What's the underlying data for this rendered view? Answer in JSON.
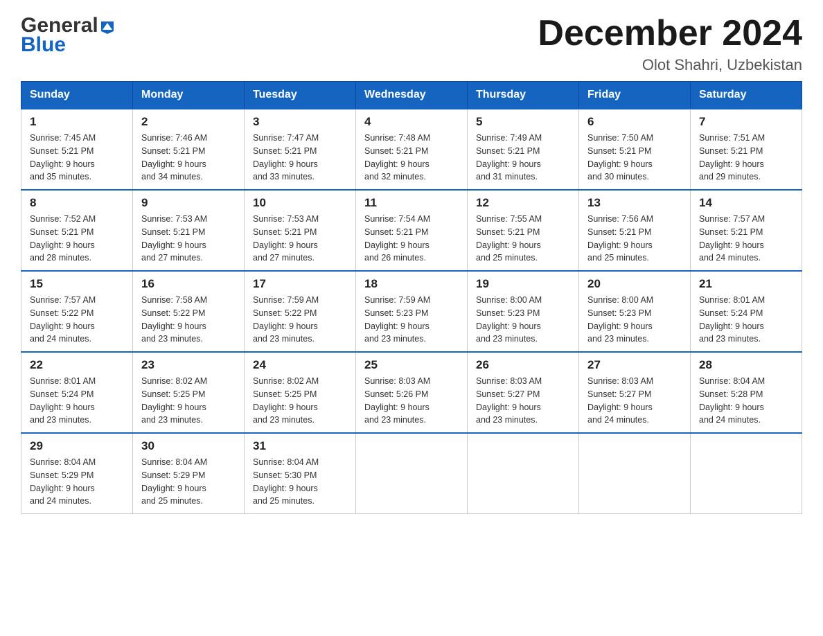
{
  "logo": {
    "line1": "General",
    "triangle": "▶",
    "line2": "Blue"
  },
  "title": "December 2024",
  "location": "Olot Shahri, Uzbekistan",
  "weekdays": [
    "Sunday",
    "Monday",
    "Tuesday",
    "Wednesday",
    "Thursday",
    "Friday",
    "Saturday"
  ],
  "weeks": [
    [
      {
        "day": "1",
        "sunrise": "7:45 AM",
        "sunset": "5:21 PM",
        "daylight_h": "9",
        "daylight_m": "35"
      },
      {
        "day": "2",
        "sunrise": "7:46 AM",
        "sunset": "5:21 PM",
        "daylight_h": "9",
        "daylight_m": "34"
      },
      {
        "day": "3",
        "sunrise": "7:47 AM",
        "sunset": "5:21 PM",
        "daylight_h": "9",
        "daylight_m": "33"
      },
      {
        "day": "4",
        "sunrise": "7:48 AM",
        "sunset": "5:21 PM",
        "daylight_h": "9",
        "daylight_m": "32"
      },
      {
        "day": "5",
        "sunrise": "7:49 AM",
        "sunset": "5:21 PM",
        "daylight_h": "9",
        "daylight_m": "31"
      },
      {
        "day": "6",
        "sunrise": "7:50 AM",
        "sunset": "5:21 PM",
        "daylight_h": "9",
        "daylight_m": "30"
      },
      {
        "day": "7",
        "sunrise": "7:51 AM",
        "sunset": "5:21 PM",
        "daylight_h": "9",
        "daylight_m": "29"
      }
    ],
    [
      {
        "day": "8",
        "sunrise": "7:52 AM",
        "sunset": "5:21 PM",
        "daylight_h": "9",
        "daylight_m": "28"
      },
      {
        "day": "9",
        "sunrise": "7:53 AM",
        "sunset": "5:21 PM",
        "daylight_h": "9",
        "daylight_m": "27"
      },
      {
        "day": "10",
        "sunrise": "7:53 AM",
        "sunset": "5:21 PM",
        "daylight_h": "9",
        "daylight_m": "27"
      },
      {
        "day": "11",
        "sunrise": "7:54 AM",
        "sunset": "5:21 PM",
        "daylight_h": "9",
        "daylight_m": "26"
      },
      {
        "day": "12",
        "sunrise": "7:55 AM",
        "sunset": "5:21 PM",
        "daylight_h": "9",
        "daylight_m": "25"
      },
      {
        "day": "13",
        "sunrise": "7:56 AM",
        "sunset": "5:21 PM",
        "daylight_h": "9",
        "daylight_m": "25"
      },
      {
        "day": "14",
        "sunrise": "7:57 AM",
        "sunset": "5:21 PM",
        "daylight_h": "9",
        "daylight_m": "24"
      }
    ],
    [
      {
        "day": "15",
        "sunrise": "7:57 AM",
        "sunset": "5:22 PM",
        "daylight_h": "9",
        "daylight_m": "24"
      },
      {
        "day": "16",
        "sunrise": "7:58 AM",
        "sunset": "5:22 PM",
        "daylight_h": "9",
        "daylight_m": "23"
      },
      {
        "day": "17",
        "sunrise": "7:59 AM",
        "sunset": "5:22 PM",
        "daylight_h": "9",
        "daylight_m": "23"
      },
      {
        "day": "18",
        "sunrise": "7:59 AM",
        "sunset": "5:23 PM",
        "daylight_h": "9",
        "daylight_m": "23"
      },
      {
        "day": "19",
        "sunrise": "8:00 AM",
        "sunset": "5:23 PM",
        "daylight_h": "9",
        "daylight_m": "23"
      },
      {
        "day": "20",
        "sunrise": "8:00 AM",
        "sunset": "5:23 PM",
        "daylight_h": "9",
        "daylight_m": "23"
      },
      {
        "day": "21",
        "sunrise": "8:01 AM",
        "sunset": "5:24 PM",
        "daylight_h": "9",
        "daylight_m": "23"
      }
    ],
    [
      {
        "day": "22",
        "sunrise": "8:01 AM",
        "sunset": "5:24 PM",
        "daylight_h": "9",
        "daylight_m": "23"
      },
      {
        "day": "23",
        "sunrise": "8:02 AM",
        "sunset": "5:25 PM",
        "daylight_h": "9",
        "daylight_m": "23"
      },
      {
        "day": "24",
        "sunrise": "8:02 AM",
        "sunset": "5:25 PM",
        "daylight_h": "9",
        "daylight_m": "23"
      },
      {
        "day": "25",
        "sunrise": "8:03 AM",
        "sunset": "5:26 PM",
        "daylight_h": "9",
        "daylight_m": "23"
      },
      {
        "day": "26",
        "sunrise": "8:03 AM",
        "sunset": "5:27 PM",
        "daylight_h": "9",
        "daylight_m": "23"
      },
      {
        "day": "27",
        "sunrise": "8:03 AM",
        "sunset": "5:27 PM",
        "daylight_h": "9",
        "daylight_m": "24"
      },
      {
        "day": "28",
        "sunrise": "8:04 AM",
        "sunset": "5:28 PM",
        "daylight_h": "9",
        "daylight_m": "24"
      }
    ],
    [
      {
        "day": "29",
        "sunrise": "8:04 AM",
        "sunset": "5:29 PM",
        "daylight_h": "9",
        "daylight_m": "24"
      },
      {
        "day": "30",
        "sunrise": "8:04 AM",
        "sunset": "5:29 PM",
        "daylight_h": "9",
        "daylight_m": "25"
      },
      {
        "day": "31",
        "sunrise": "8:04 AM",
        "sunset": "5:30 PM",
        "daylight_h": "9",
        "daylight_m": "25"
      },
      null,
      null,
      null,
      null
    ]
  ]
}
